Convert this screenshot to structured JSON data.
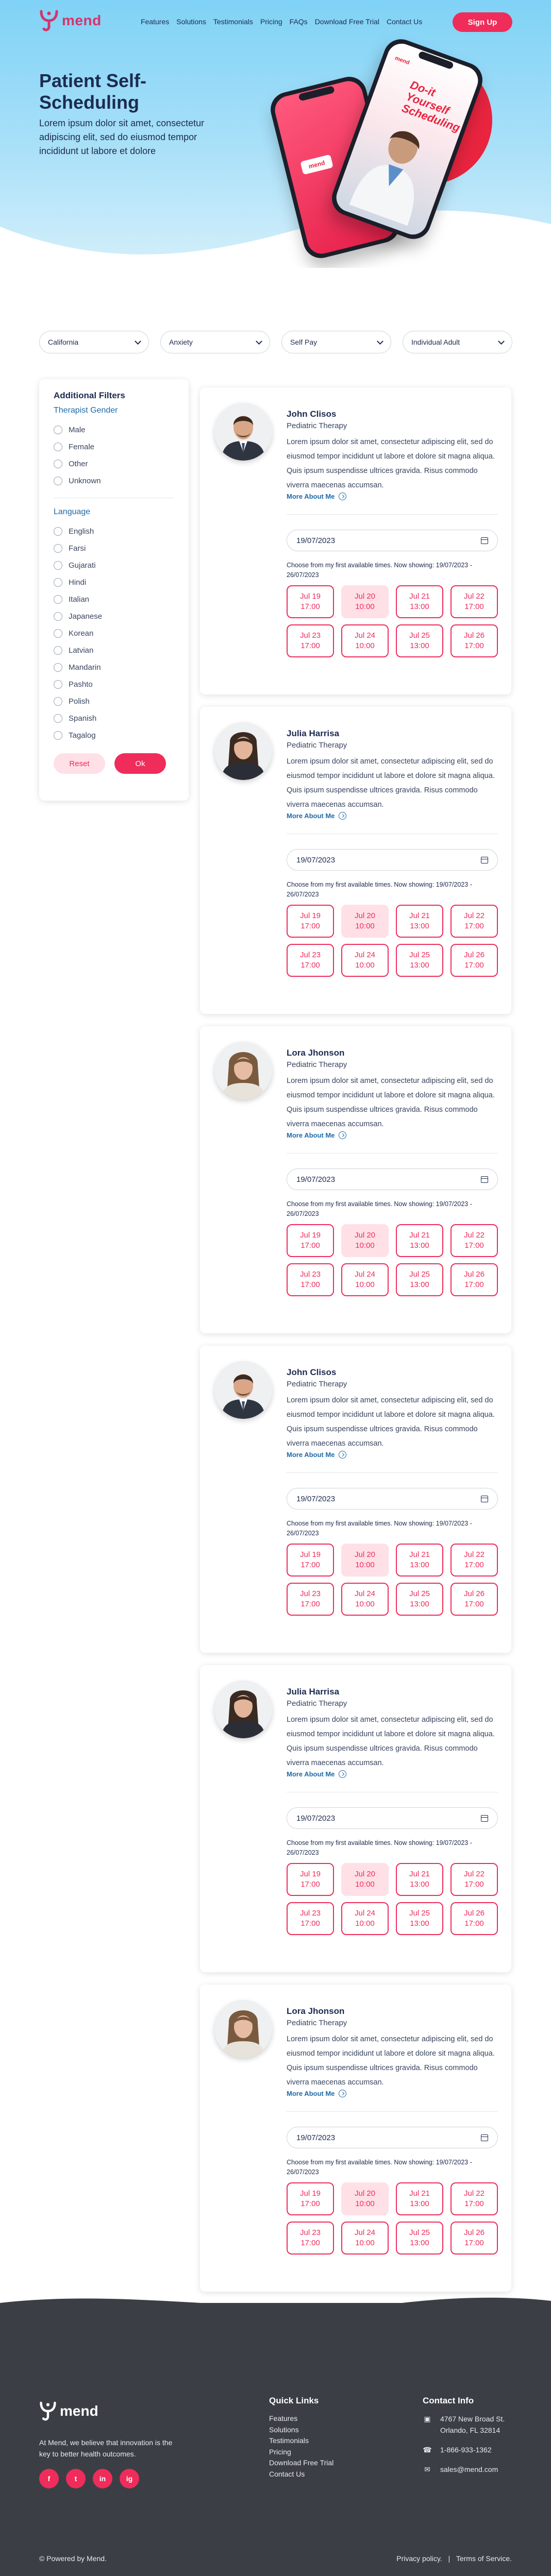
{
  "nav": {
    "logo_text": "mend",
    "links": [
      "Features",
      "Solutions",
      "Testimonials",
      "Pricing",
      "FAQs",
      "Download Free Trial",
      "Contact Us"
    ],
    "signup_label": "Sign Up"
  },
  "hero": {
    "title": "Patient Self-Scheduling",
    "subtitle": "Lorem ipsum dolor sit amet, consectetur adipiscing elit, sed do eiusmod tempor incididunt ut labore et dolore",
    "phone_small_logo": "mend",
    "phone_big_headline": "Do-it Yourself Scheduling",
    "phone_big_logo": "mend"
  },
  "selects": [
    "California",
    "Anxiety",
    "Self Pay",
    "Individual Adult"
  ],
  "sidebar": {
    "title": "Additional Filters",
    "gender_heading": "Therapist Gender",
    "genders": [
      "Male",
      "Female",
      "Other",
      "Unknown"
    ],
    "language_heading": "Language",
    "languages": [
      "English",
      "Farsi",
      "Gujarati",
      "Hindi",
      "Italian",
      "Japanese",
      "Korean",
      "Latvian",
      "Mandarin",
      "Pashto",
      "Polish",
      "Spanish",
      "Tagalog"
    ],
    "reset_label": "Reset",
    "ok_label": "Ok"
  },
  "common": {
    "bio": "Lorem ipsum dolor sit amet, consectetur adipiscing elit, sed do eiusmod tempor incididunt ut labore et dolore sit magna aliqua. Quis ipsum suspendisse ultrices gravida. Risus commodo viverra maecenas accumsan.",
    "more_label": "More About Me",
    "date": "19/07/2023",
    "choose_text": "Choose from my first available times. Now showing: 19/07/2023 - 26/07/2023",
    "slots": [
      {
        "day": "Jul 19",
        "time": "17:00"
      },
      {
        "day": "Jul 20",
        "time": "10:00"
      },
      {
        "day": "Jul 21",
        "time": "13:00"
      },
      {
        "day": "Jul 22",
        "time": "17:00"
      },
      {
        "day": "Jul 23",
        "time": "17:00"
      },
      {
        "day": "Jul 24",
        "time": "10:00"
      },
      {
        "day": "Jul 25",
        "time": "13:00"
      },
      {
        "day": "Jul 26",
        "time": "17:00"
      }
    ],
    "selected_slot": 1
  },
  "doctors": [
    {
      "name": "John Clisos",
      "specialty": "Pediatric Therapy",
      "gender": "male"
    },
    {
      "name": "Julia Harrisa",
      "specialty": "Pediatric Therapy",
      "gender": "female"
    },
    {
      "name": "Lora Jhonson",
      "specialty": "Pediatric Therapy",
      "gender": "female2"
    },
    {
      "name": "John Clisos",
      "specialty": "Pediatric Therapy",
      "gender": "male"
    },
    {
      "name": "Julia Harrisa",
      "specialty": "Pediatric Therapy",
      "gender": "female"
    },
    {
      "name": "Lora Jhonson",
      "specialty": "Pediatric Therapy",
      "gender": "female2"
    }
  ],
  "footer": {
    "logo_text": "mend",
    "description": "At Mend, we believe that innovation is the key to better health outcomes.",
    "social": [
      "f",
      "t",
      "in",
      "ig"
    ],
    "quick_links_title": "Quick Links",
    "quick_links": [
      "Features",
      "Solutions",
      "Testimonials",
      "Pricing",
      "Download Free Trial",
      "Contact Us"
    ],
    "contact_title": "Contact Info",
    "address_line1": "4767 New Broad St.",
    "address_line2": "Orlando, FL 32814",
    "phone": "1-866-933-1362",
    "email": "sales@mend.com",
    "copyright": "© Powered by Mend.",
    "privacy": "Privacy policy.",
    "separator": "|",
    "terms": "Terms of Service."
  },
  "colors": {
    "accent": "#ef2c5a",
    "link": "#1e6aa8",
    "text": "#1d2b4f",
    "footer_bg": "#3b3f45"
  }
}
